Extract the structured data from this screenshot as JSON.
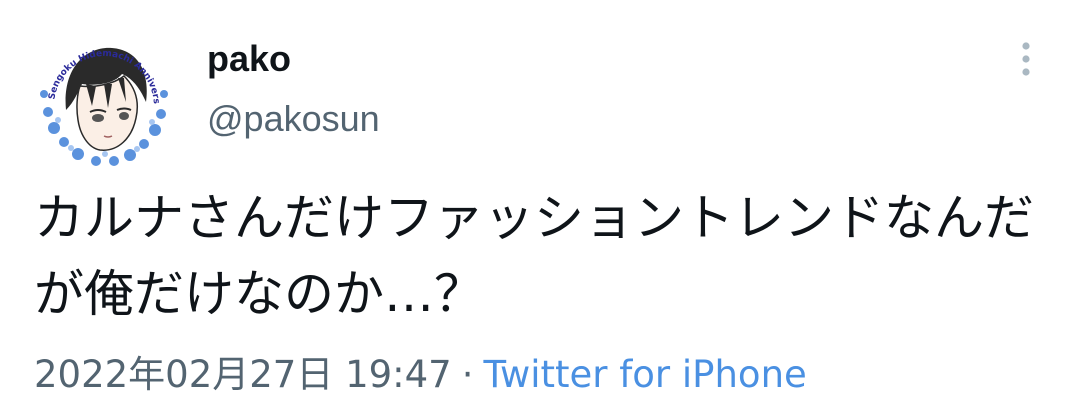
{
  "tweet": {
    "display_name": "pako",
    "handle": "@pakosun",
    "text": "カルナさんだけファッショントレンドなんだが俺だけなのか…？",
    "timestamp": "2022年02月27日 19:47",
    "separator": "·",
    "source": "Twitter for iPhone",
    "more_icon": "more-vertical-icon",
    "avatar_ring_text": "Sengoku Hidemachi Anniversary",
    "colors": {
      "name": "#0f1419",
      "secondary": "#536471",
      "link": "#4a90e2"
    }
  }
}
